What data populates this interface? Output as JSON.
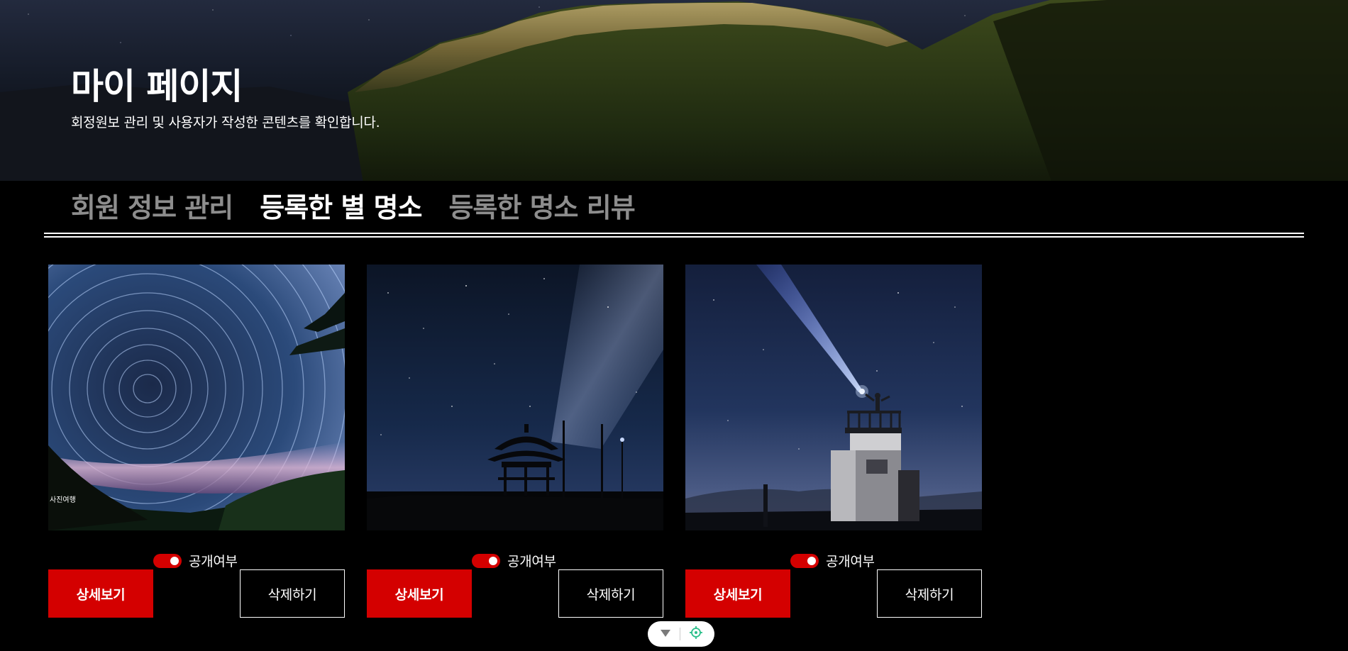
{
  "header": {
    "title": "마이 페이지",
    "subtitle": "회정원보 관리 및 사용자가 작성한 콘텐츠를 확인합니다."
  },
  "tabs": [
    {
      "label": "회원 정보 관리",
      "active": false
    },
    {
      "label": "등록한 별 명소",
      "active": true
    },
    {
      "label": "등록한 명소 리뷰",
      "active": false
    }
  ],
  "cards": [
    {
      "visibility_label": "공개여부",
      "visibility_on": true,
      "detail_label": "상세보기",
      "delete_label": "삭제하기",
      "image_text": [
        "사진여행"
      ]
    },
    {
      "visibility_label": "공개여부",
      "visibility_on": true,
      "detail_label": "상세보기",
      "delete_label": "삭제하기"
    },
    {
      "visibility_label": "공개여부",
      "visibility_on": true,
      "detail_label": "상세보기",
      "delete_label": "삭제하기"
    }
  ],
  "colors": {
    "accent": "#d40000",
    "background": "#000000",
    "inactive_tab": "#8d8d8d"
  },
  "widget": {
    "icons": [
      "chevron-down-icon",
      "crosshair-icon"
    ]
  }
}
